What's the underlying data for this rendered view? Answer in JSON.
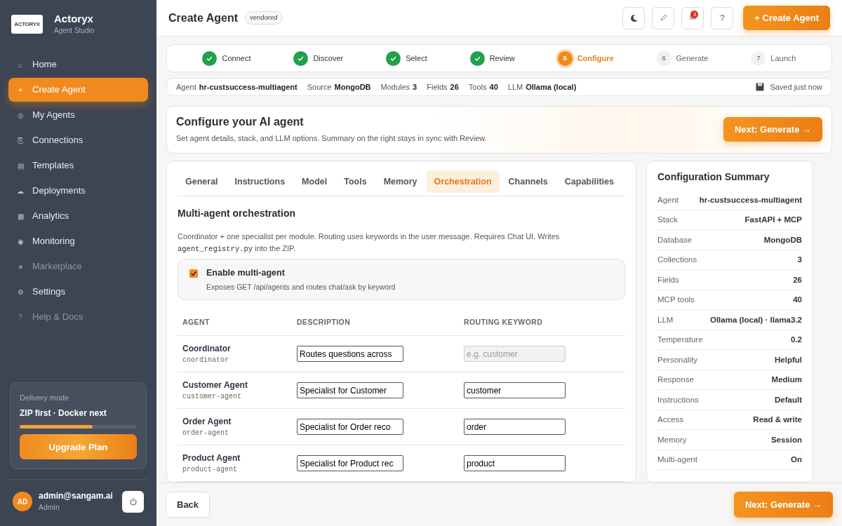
{
  "brand": {
    "logo_text": "ACTORYX",
    "name": "Actoryx",
    "subtitle": "Agent Studio"
  },
  "sidebar": {
    "items": [
      {
        "icon": "⌂",
        "label": "Home",
        "selected": false,
        "disabled": false
      },
      {
        "icon": "+",
        "label": "Create Agent",
        "selected": true,
        "disabled": false
      },
      {
        "icon": "◎",
        "label": "My Agents",
        "selected": false,
        "disabled": false
      },
      {
        "icon": "⎘",
        "label": "Connections",
        "selected": false,
        "disabled": false
      },
      {
        "icon": "▤",
        "label": "Templates",
        "selected": false,
        "disabled": false
      },
      {
        "icon": "☁",
        "label": "Deployments",
        "selected": false,
        "disabled": false
      },
      {
        "icon": "▦",
        "label": "Analytics",
        "selected": false,
        "disabled": false
      },
      {
        "icon": "◉",
        "label": "Monitoring",
        "selected": false,
        "disabled": false
      },
      {
        "icon": "★",
        "label": "Marketplace",
        "selected": false,
        "disabled": true
      },
      {
        "icon": "⚙",
        "label": "Settings",
        "selected": false,
        "disabled": false
      },
      {
        "icon": "?",
        "label": "Help & Docs",
        "selected": false,
        "disabled": true
      }
    ],
    "delivery": {
      "label": "Delivery mode",
      "value": "ZIP first · Docker next",
      "level": 0.62,
      "button": "Upgrade Plan"
    },
    "user": {
      "initials": "AD",
      "email": "admin@sangam.ai",
      "role": "Admin"
    }
  },
  "header": {
    "title": "Create Agent",
    "badge": "vendored",
    "icon_buttons": [
      {
        "kind": "theme"
      },
      {
        "kind": "edit"
      },
      {
        "kind": "notifications",
        "badge": "3"
      },
      {
        "kind": "help",
        "label": "?"
      }
    ],
    "primary_button": "+ Create Agent"
  },
  "steps": [
    {
      "label": "Connect",
      "completed": true,
      "selected": false
    },
    {
      "label": "Discover",
      "completed": true,
      "selected": false
    },
    {
      "label": "Select",
      "completed": true,
      "selected": false
    },
    {
      "label": "Review",
      "completed": true,
      "selected": false
    },
    {
      "number": "5",
      "label": "Configure",
      "completed": false,
      "selected": true
    },
    {
      "number": "6",
      "label": "Generate",
      "completed": false,
      "selected": false
    },
    {
      "number": "7",
      "label": "Launch",
      "completed": false,
      "selected": false
    }
  ],
  "info_bar": {
    "items": [
      {
        "label": "Agent",
        "value": "hr-custsuccess-multiagent"
      },
      {
        "label": "Source",
        "value": "MongoDB"
      },
      {
        "label": "Modules",
        "value": "3"
      },
      {
        "label": "Fields",
        "value": "26"
      },
      {
        "label": "Tools",
        "value": "40"
      },
      {
        "label": "LLM",
        "value": "Ollama (local)"
      }
    ],
    "saved": "Saved just now"
  },
  "hero": {
    "title": "Configure your AI agent",
    "subtitle": "Set agent details, stack, and LLM options. Summary on the right stays in sync with Review.",
    "button": "Next: Generate →"
  },
  "tabs": [
    {
      "label": "General",
      "selected": false
    },
    {
      "label": "Instructions",
      "selected": false
    },
    {
      "label": "Model",
      "selected": false
    },
    {
      "label": "Tools",
      "selected": false
    },
    {
      "label": "Memory",
      "selected": false
    },
    {
      "label": "Orchestration",
      "selected": true
    },
    {
      "label": "Channels",
      "selected": false
    },
    {
      "label": "Capabilities",
      "selected": false
    }
  ],
  "section": {
    "title": "Multi-agent orchestration",
    "description_before": "Coordinator + one specialist per module. Routing uses keywords in the user message. Requires Chat UI. Writes",
    "description_code": "agent_registry.py",
    "description_after": "into the ZIP.",
    "toggle": {
      "label": "Enable multi-agent",
      "hint": "Exposes GET /api/agents and routes chat/ask by keyword",
      "checked": true
    }
  },
  "table": {
    "columns": [
      "AGENT",
      "DESCRIPTION",
      "ROUTING KEYWORD"
    ],
    "rows": [
      {
        "name": "Coordinator",
        "id": "coordinator",
        "description": "Routes questions across",
        "keyword_placeholder": "e.g. customer",
        "keyword_disabled": true
      },
      {
        "name": "Customer Agent",
        "id": "customer-agent",
        "description": "Specialist for Customer",
        "keyword": "customer",
        "keyword_disabled": false
      },
      {
        "name": "Order Agent",
        "id": "order-agent",
        "description": "Specialist for Order reco",
        "keyword": "order",
        "keyword_disabled": false
      },
      {
        "name": "Product Agent",
        "id": "product-agent",
        "description": "Specialist for Product rec",
        "keyword": "product",
        "keyword_disabled": false
      }
    ]
  },
  "summary": {
    "title": "Configuration Summary",
    "rows": [
      {
        "label": "Agent",
        "value": "hr-custsuccess-multiagent"
      },
      {
        "label": "Stack",
        "value": "FastAPI + MCP"
      },
      {
        "label": "Database",
        "value": "MongoDB"
      },
      {
        "label": "Collections",
        "value": "3"
      },
      {
        "label": "Fields",
        "value": "26"
      },
      {
        "label": "MCP tools",
        "value": "40"
      },
      {
        "label": "LLM",
        "value": "Ollama (local) · llama3.2"
      },
      {
        "label": "Temperature",
        "value": "0.2"
      },
      {
        "label": "Personality",
        "value": "Helpful"
      },
      {
        "label": "Response",
        "value": "Medium"
      },
      {
        "label": "Instructions",
        "value": "Default"
      },
      {
        "label": "Access",
        "value": "Read & write"
      },
      {
        "label": "Memory",
        "value": "Session"
      },
      {
        "label": "Multi-agent",
        "value": "On"
      }
    ]
  },
  "footer": {
    "back": "Back",
    "next": "Next: Generate →"
  }
}
